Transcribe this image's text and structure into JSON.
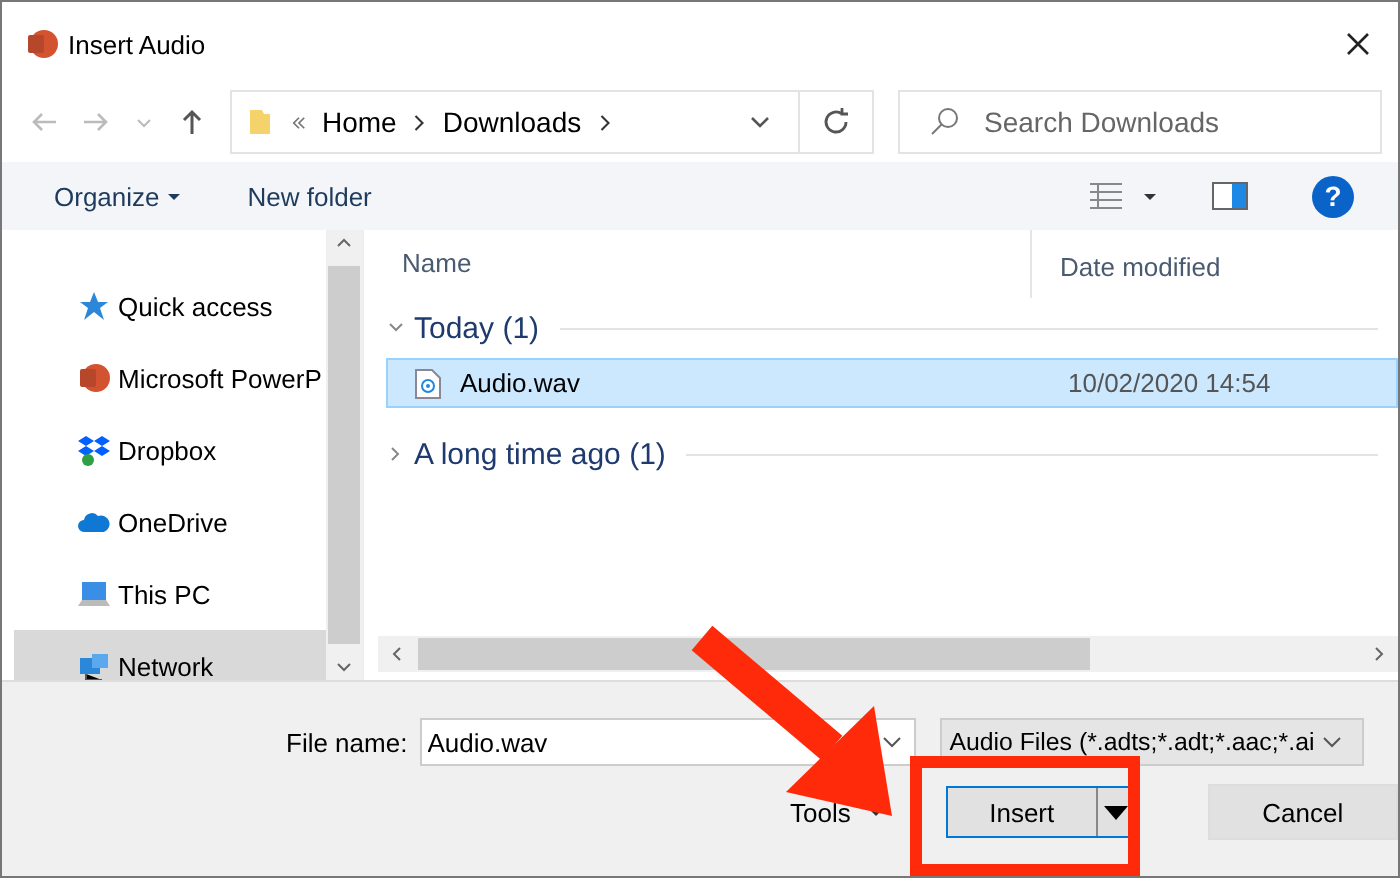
{
  "window": {
    "title": "Insert Audio"
  },
  "address": {
    "path": [
      "Home",
      "Downloads"
    ]
  },
  "search": {
    "placeholder": "Search Downloads"
  },
  "toolbar": {
    "organize": "Organize",
    "new_folder": "New folder",
    "help": "?"
  },
  "sidebar": {
    "items": [
      {
        "label": "Quick access",
        "kind": "star",
        "selected": false
      },
      {
        "label": "Microsoft PowerP",
        "kind": "powerpoint",
        "selected": false
      },
      {
        "label": "Dropbox",
        "kind": "dropbox",
        "selected": false
      },
      {
        "label": "OneDrive",
        "kind": "cloud",
        "selected": false
      },
      {
        "label": "This PC",
        "kind": "pc",
        "selected": false
      },
      {
        "label": "Network",
        "kind": "network",
        "selected": true
      }
    ]
  },
  "columns": [
    "Name",
    "Date modified"
  ],
  "groups": [
    {
      "label": "Today (1)",
      "expanded": true,
      "files": [
        {
          "name": "Audio.wav",
          "date": "10/02/2020 14:54",
          "selected": true
        }
      ]
    },
    {
      "label": "A long time ago (1)",
      "expanded": false
    }
  ],
  "file_name": {
    "label": "File name:",
    "value": "Audio.wav"
  },
  "file_type": "Audio Files (*.adts;*.adt;*.aac;*.ai",
  "buttons": {
    "tools": "Tools",
    "insert": "Insert",
    "cancel": "Cancel"
  }
}
